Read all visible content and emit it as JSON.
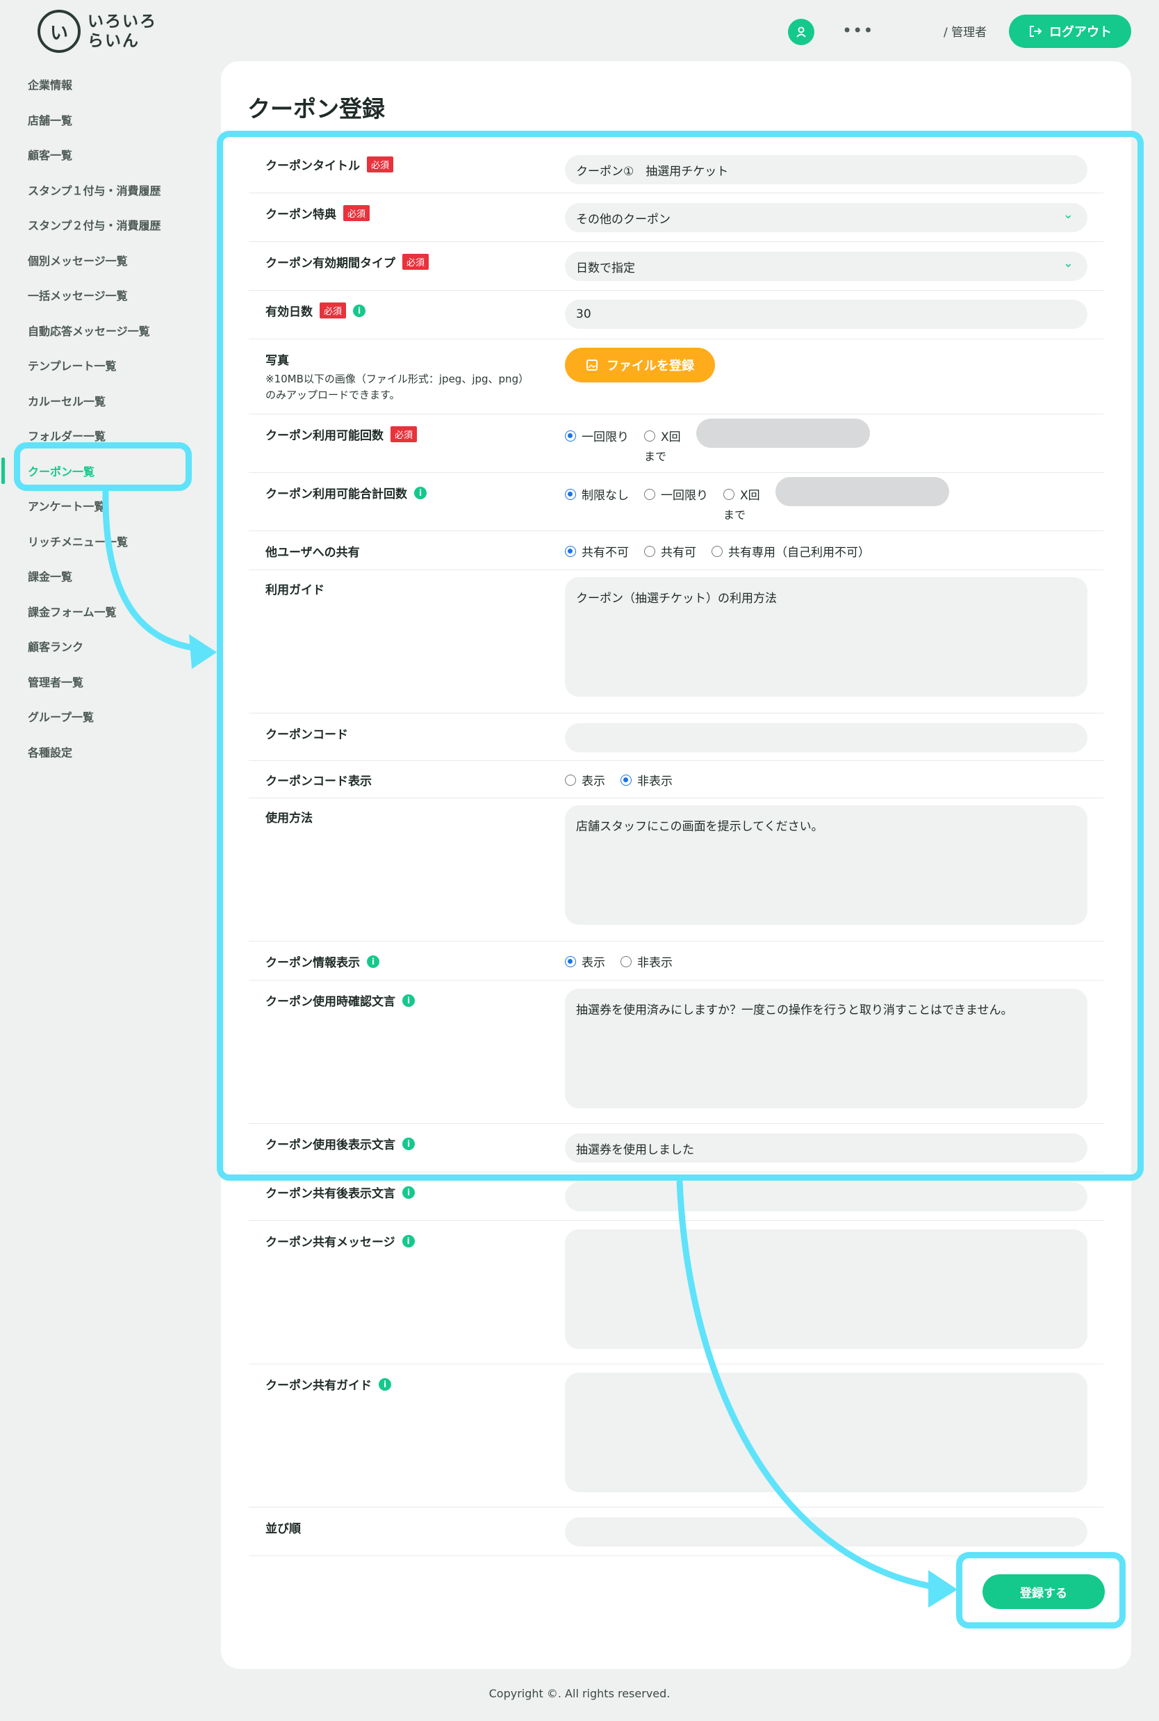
{
  "header": {
    "logo_mark": "い",
    "logo_line1": "いろいろ",
    "logo_line2": "らいん",
    "more": "•••",
    "admin_label": "/ 管理者",
    "logout_label": "ログアウト"
  },
  "sidebar": {
    "items": [
      {
        "label": "企業情報"
      },
      {
        "label": "店舗一覧"
      },
      {
        "label": "顧客一覧"
      },
      {
        "label": "スタンプ１付与・消費履歴"
      },
      {
        "label": "スタンプ２付与・消費履歴"
      },
      {
        "label": "個別メッセージ一覧"
      },
      {
        "label": "一括メッセージ一覧"
      },
      {
        "label": "自動応答メッセージ一覧"
      },
      {
        "label": "テンプレート一覧"
      },
      {
        "label": "カルーセル一覧"
      },
      {
        "label": "フォルダー一覧"
      },
      {
        "label": "クーポン一覧"
      },
      {
        "label": "アンケート一覧"
      },
      {
        "label": "リッチメニュー一覧"
      },
      {
        "label": "課金一覧"
      },
      {
        "label": "課金フォーム一覧"
      },
      {
        "label": "顧客ランク"
      },
      {
        "label": "管理者一覧"
      },
      {
        "label": "グループ一覧"
      },
      {
        "label": "各種設定"
      }
    ]
  },
  "page": {
    "title": "クーポン登録",
    "required_badge": "必須",
    "info_icon": "i"
  },
  "form": {
    "coupon_title": {
      "label": "クーポンタイトル",
      "value": "クーポン①　抽選用チケット"
    },
    "benefit": {
      "label": "クーポン特典",
      "value": "その他のクーポン"
    },
    "period_type": {
      "label": "クーポン有効期間タイプ",
      "value": "日数で指定"
    },
    "valid_days": {
      "label": "有効日数",
      "value": "30"
    },
    "photo": {
      "label": "写真",
      "note_line1": "※10MB以下の画像（ファイル形式：jpeg、jpg、png）",
      "note_line2": "のみアップロードできます。",
      "button": "ファイルを登録"
    },
    "usable_count": {
      "label": "クーポン利用可能回数",
      "opt1": "一回限り",
      "opt2": "X回",
      "made": "まで"
    },
    "usable_total": {
      "label": "クーポン利用可能合計回数",
      "opt1": "制限なし",
      "opt2": "一回限り",
      "opt3": "X回",
      "made": "まで"
    },
    "share": {
      "label": "他ユーザへの共有",
      "opt1": "共有不可",
      "opt2": "共有可",
      "opt3": "共有専用（自己利用不可）"
    },
    "guide": {
      "label": "利用ガイド",
      "value": "クーポン（抽選チケット）の利用方法"
    },
    "code": {
      "label": "クーポンコード",
      "value": ""
    },
    "code_display": {
      "label": "クーポンコード表示",
      "opt1": "表示",
      "opt2": "非表示"
    },
    "usage": {
      "label": "使用方法",
      "value": "店舗スタッフにこの画面を提示してください。"
    },
    "info_display": {
      "label": "クーポン情報表示",
      "opt1": "表示",
      "opt2": "非表示"
    },
    "confirm_text": {
      "label": "クーポン使用時確認文言",
      "value": "抽選券を使用済みにしますか？一度この操作を行うと取り消すことはできません。"
    },
    "after_use_text": {
      "label": "クーポン使用後表示文言",
      "value": "抽選券を使用しました"
    },
    "after_share_text": {
      "label": "クーポン共有後表示文言",
      "value": ""
    },
    "share_message": {
      "label": "クーポン共有メッセージ",
      "value": ""
    },
    "share_guide": {
      "label": "クーポン共有ガイド",
      "value": ""
    },
    "order": {
      "label": "並び順",
      "value": ""
    },
    "submit_label": "登録する"
  },
  "footer": {
    "copyright": "Copyright ©. All rights reserved."
  },
  "colors": {
    "accent": "#14c98b",
    "required": "#e8323c",
    "file_button": "#ffac1c",
    "annotation": "#5ee3fa"
  }
}
